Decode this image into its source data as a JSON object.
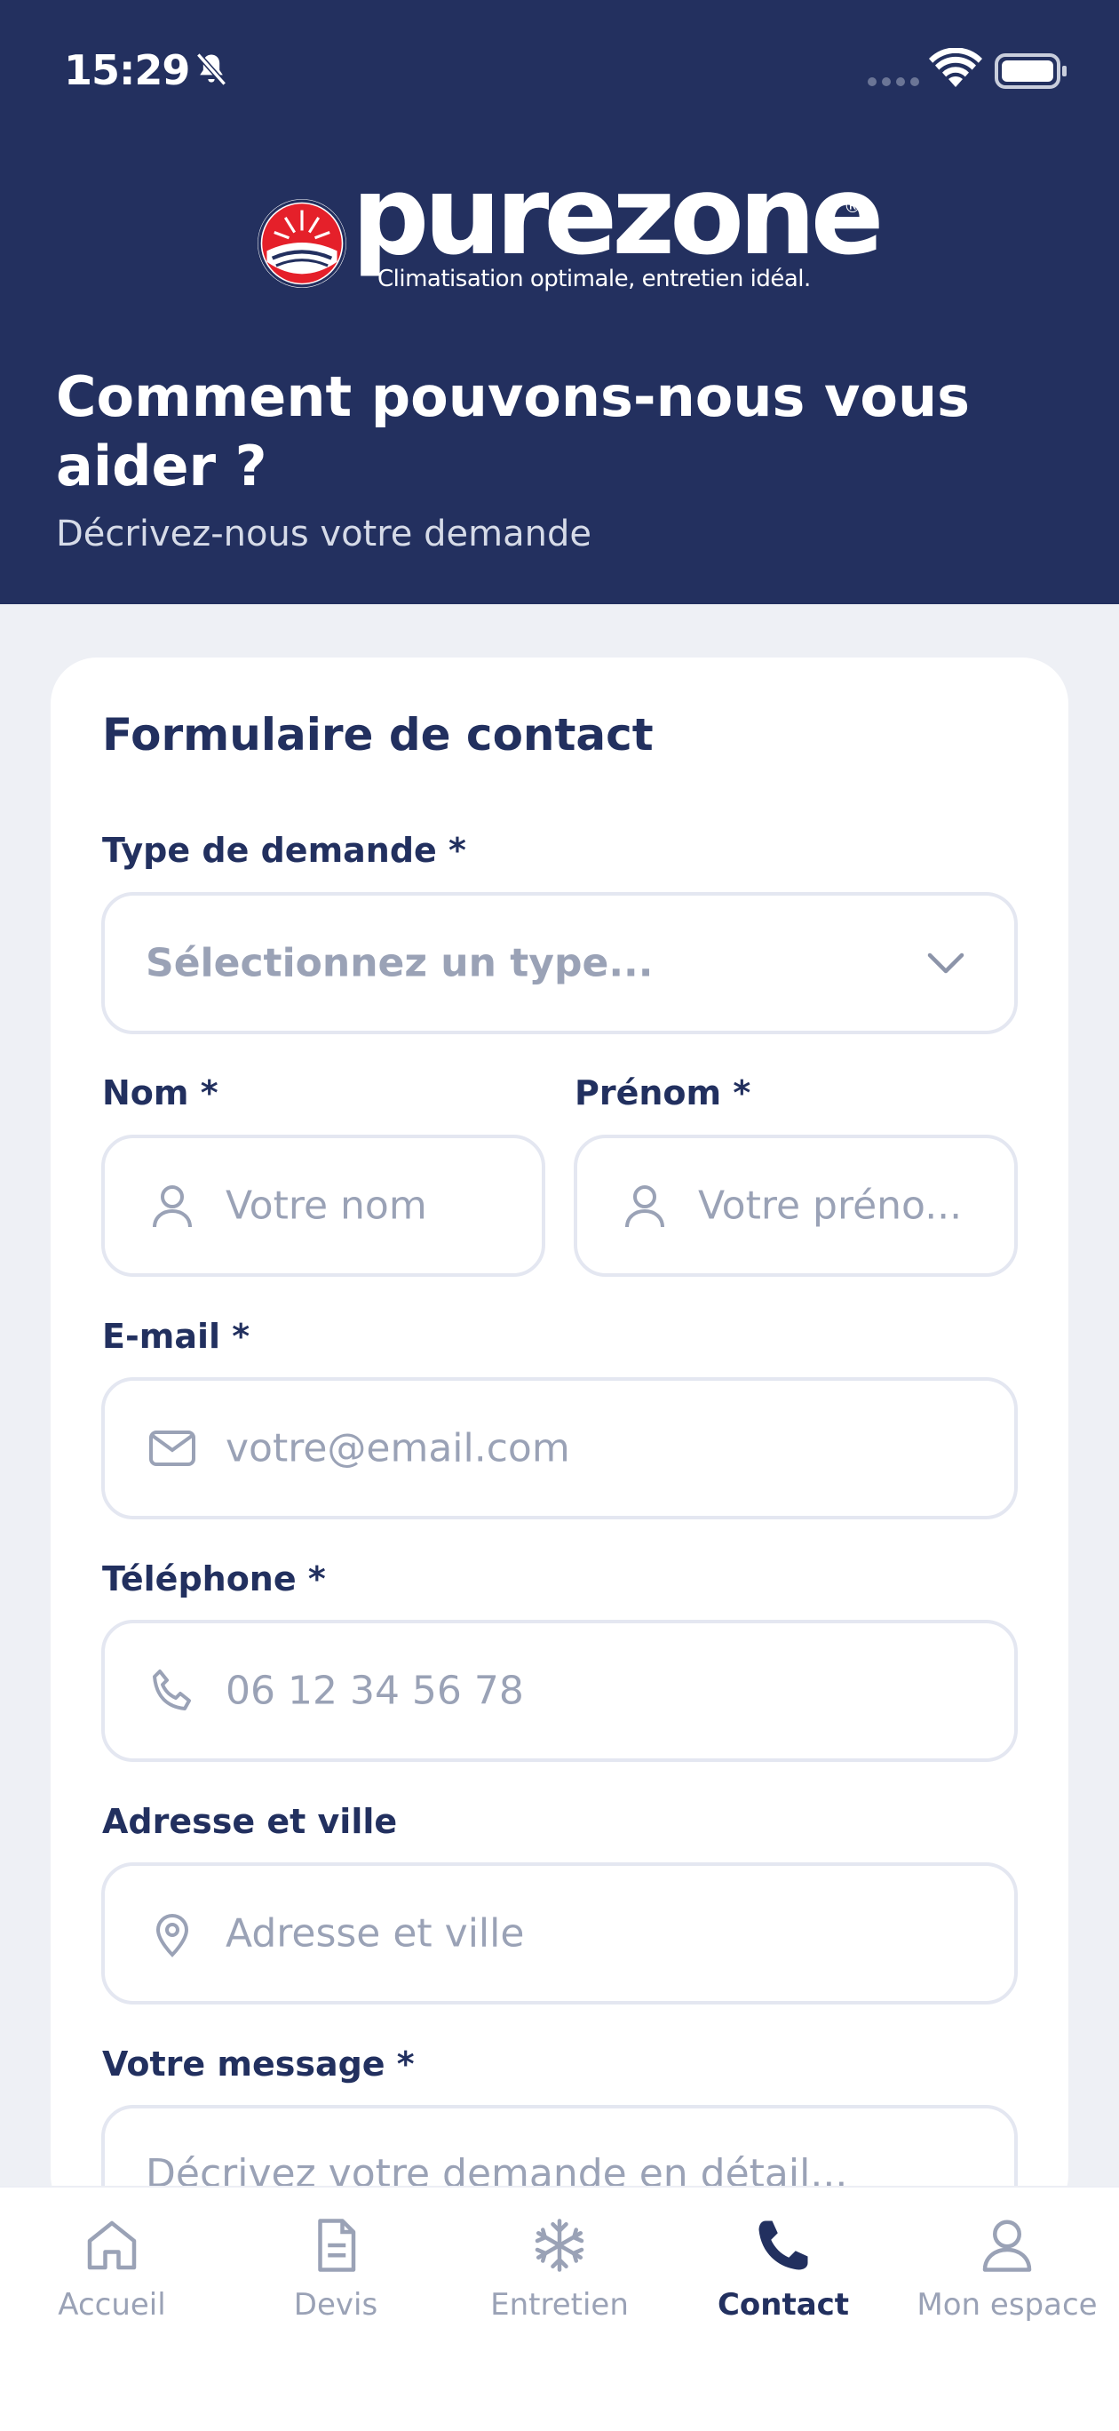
{
  "status_bar": {
    "time": "15:29"
  },
  "brand": {
    "name": "purezone",
    "registered": "®",
    "tagline": "Climatisation optimale, entretien idéal."
  },
  "header": {
    "title": "Comment pouvons-nous vous aider ?",
    "subtitle": "Décrivez-nous votre demande"
  },
  "form": {
    "title": "Formulaire de contact",
    "type": {
      "label": "Type de demande *",
      "placeholder": "Sélectionnez un type..."
    },
    "nom": {
      "label": "Nom *",
      "placeholder": "Votre nom"
    },
    "prenom": {
      "label": "Prénom *",
      "placeholder": "Votre préno..."
    },
    "email": {
      "label": "E-mail *",
      "placeholder": "votre@email.com"
    },
    "telephone": {
      "label": "Téléphone *",
      "placeholder": "06 12 34 56 78"
    },
    "adresse": {
      "label": "Adresse et ville",
      "placeholder": "Adresse et ville"
    },
    "message": {
      "label": "Votre message *",
      "placeholder": "Décrivez votre demande en détail..."
    }
  },
  "tabs": [
    {
      "label": "Accueil",
      "icon": "home-icon",
      "active": false
    },
    {
      "label": "Devis",
      "icon": "document-icon",
      "active": false
    },
    {
      "label": "Entretien",
      "icon": "snowflake-icon",
      "active": false
    },
    {
      "label": "Contact",
      "icon": "phone-icon",
      "active": true
    },
    {
      "label": "Mon espace",
      "icon": "user-icon",
      "active": false
    }
  ],
  "colors": {
    "primary": "#23305f",
    "background": "#eef0f5",
    "placeholder": "#9aa2b6",
    "logo_red": "#e5202a"
  }
}
